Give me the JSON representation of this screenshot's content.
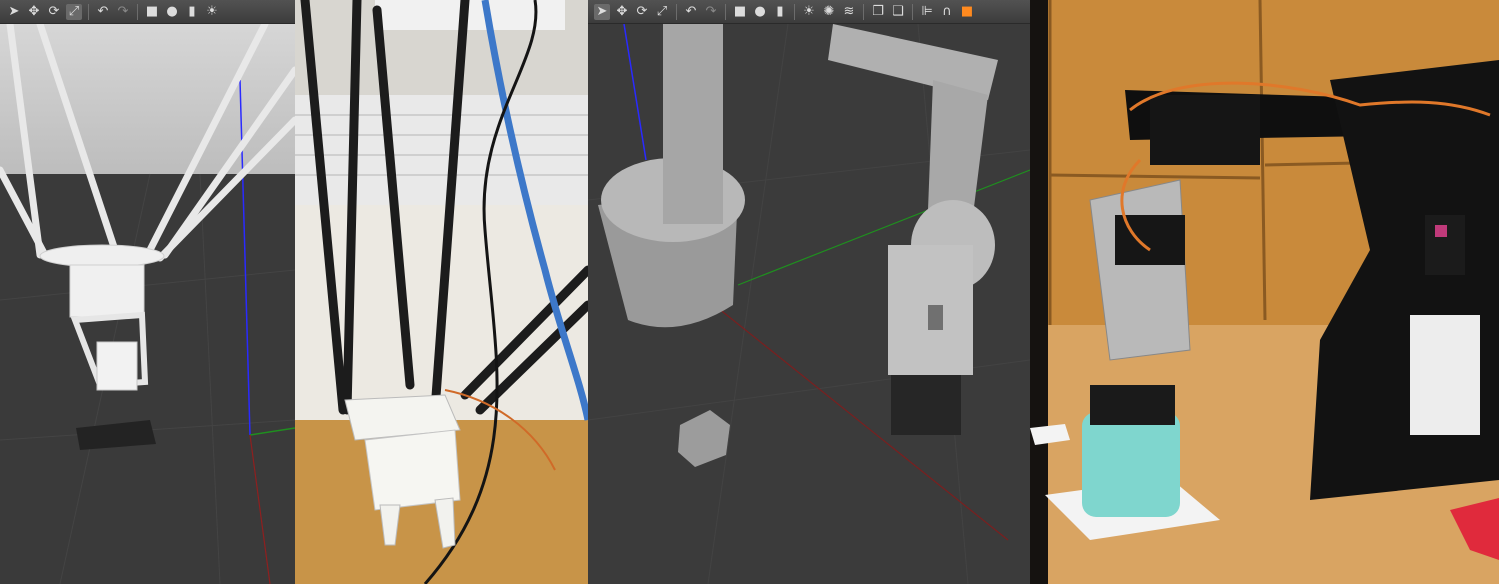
{
  "panels": [
    {
      "id": "sim-delta",
      "kind": "simulation",
      "scene": "delta robot with gripper and cube"
    },
    {
      "id": "photo-delta",
      "kind": "photo",
      "scene": "physical delta robot with gripper"
    },
    {
      "id": "sim-arm",
      "kind": "simulation",
      "scene": "robotic arm gripper and cube"
    },
    {
      "id": "photo-arm",
      "kind": "photo",
      "scene": "physical servo robot arm above cylinder"
    }
  ],
  "toolbar_icons": [
    "select-icon",
    "translate-icon",
    "rotate-icon",
    "scale-icon",
    "undo-icon",
    "redo-icon",
    "box-icon",
    "sphere-icon",
    "cylinder-icon",
    "light-icon",
    "spotlight-icon",
    "dirlight-icon",
    "copy-icon",
    "paste-icon",
    "align-icon",
    "magnet-icon",
    "color-icon"
  ],
  "colors": {
    "sim_bg": "#3b3b3b",
    "sim_floor": "#2e2e2e",
    "model_white": "#e6e6e6",
    "model_gray": "#8c8c8c",
    "axis_blue": "#2a2aff",
    "axis_green": "#1f8f1f",
    "axis_red": "#8f1f1f",
    "servo_cable_orange": "#e0782a",
    "cylinder_teal": "#78d8cf",
    "wall_wood": "#c9893a"
  }
}
